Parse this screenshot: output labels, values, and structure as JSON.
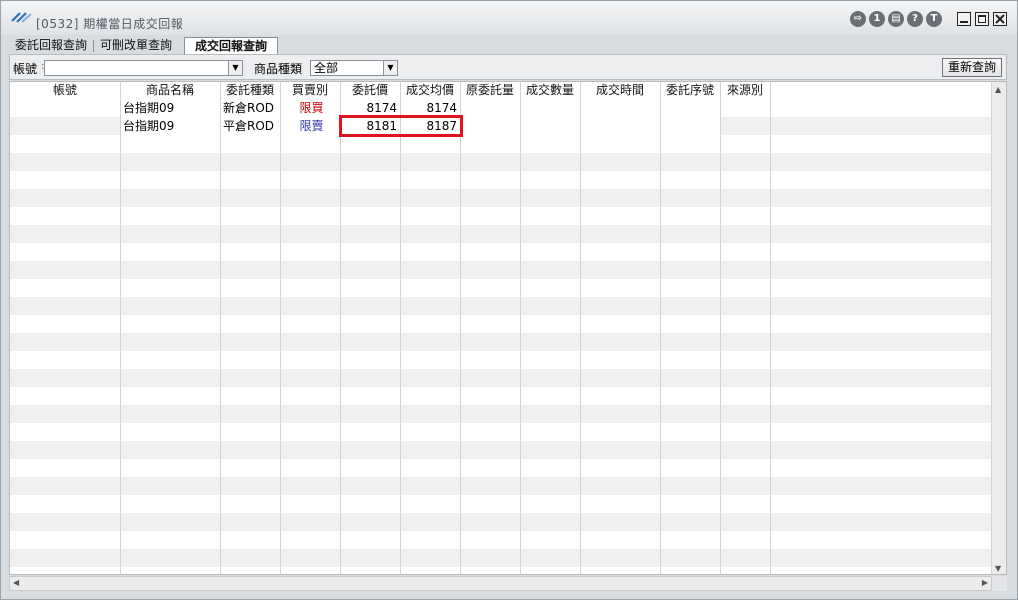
{
  "window": {
    "title": "[0532] 期權當日成交回報",
    "title_icons": [
      "exit-icon",
      "number-one-icon",
      "print-icon",
      "help-icon",
      "t-icon"
    ],
    "icon_glyphs": [
      "⇨",
      "1",
      "▤",
      "?",
      "T"
    ]
  },
  "tabs": [
    {
      "label": "委託回報查詢",
      "active": false
    },
    {
      "label": "可刪改單查詢",
      "active": false
    },
    {
      "label": "成交回報查詢",
      "active": true
    }
  ],
  "filters": {
    "account_label": "帳號",
    "account_value": "",
    "product_type_label": "商品種類",
    "product_type_value": "全部",
    "refresh_label": "重新查詢"
  },
  "table": {
    "columns": [
      "帳號",
      "商品名稱",
      "委託種類",
      "買賣別",
      "委託價",
      "成交均價",
      "原委託量",
      "成交數量",
      "成交時間",
      "委託序號",
      "來源別"
    ],
    "rows": [
      {
        "account": "",
        "product": "台指期09",
        "order_type": "新倉ROD",
        "side": "限買",
        "order_price": "8174",
        "avg_price": "8174",
        "orig_qty": "",
        "fill_qty": "",
        "fill_time": "",
        "order_no": "",
        "source": ""
      },
      {
        "account": "",
        "product": "台指期09",
        "order_type": "平倉ROD",
        "side": "限賣",
        "order_price": "8181",
        "avg_price": "8187",
        "orig_qty": "",
        "fill_qty": "",
        "fill_time": "",
        "order_no": "",
        "source": ""
      }
    ],
    "highlighted_row": 1
  },
  "colors": {
    "buy": "#c00000",
    "sell": "#3333aa",
    "highlight": "#e0151b"
  }
}
